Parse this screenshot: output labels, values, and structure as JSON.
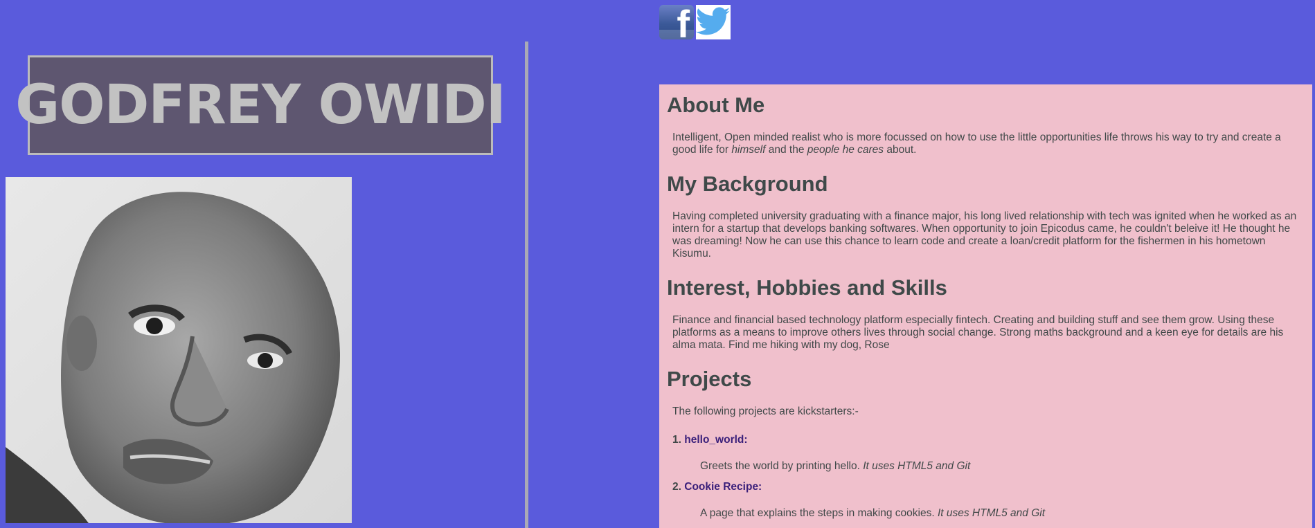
{
  "header": {
    "name": "GODFREY OWIDI",
    "social": [
      {
        "icon": "facebook-icon",
        "glyph": "f",
        "color": "#3b5998"
      },
      {
        "icon": "twitter-icon",
        "color": "#55acee"
      }
    ]
  },
  "colors": {
    "page_background": "#5a5bdc",
    "name_box": "#5e5670",
    "content_background": "#f0c0cc",
    "link": "#3a1f7a"
  },
  "about": {
    "heading": "About Me",
    "text_a": "Intelligent, Open minded realist who is more focussed on how to use the little opportunities life throws his way to try and create a good life for ",
    "text_em1": "himself",
    "text_b": " and the ",
    "text_em2": "people he cares",
    "text_c": " about."
  },
  "background": {
    "heading": "My Background",
    "text": "Having completed university graduating with a finance major, his long lived relationship with tech was ignited when he worked as an intern for a startup that develops banking softwares. When opportunity to join Epicodus came, he couldn't beleive it! He thought he was dreaming! Now he can use this chance to learn code and create a loan/credit platform for the fishermen in his hometown Kisumu."
  },
  "interests": {
    "heading": "Interest, Hobbies and Skills",
    "text": "Finance and financial based technology platform especially fintech. Creating and building stuff and see them grow. Using these platforms as a means to improve others lives through social change. Strong maths background and a keen eye for details are his alma mata. Find me hiking with my dog, Rose"
  },
  "projects": {
    "heading": "Projects",
    "intro": "The following projects are kickstarters:-",
    "items": [
      {
        "num": "1.",
        "title": "hello_world:",
        "desc": "Greets the world by printing hello. ",
        "tech": "It uses HTML5 and Git"
      },
      {
        "num": "2.",
        "title": "Cookie Recipe:",
        "desc": "A page that explains the steps in making cookies. ",
        "tech": "It uses HTML5 and Git"
      }
    ]
  }
}
